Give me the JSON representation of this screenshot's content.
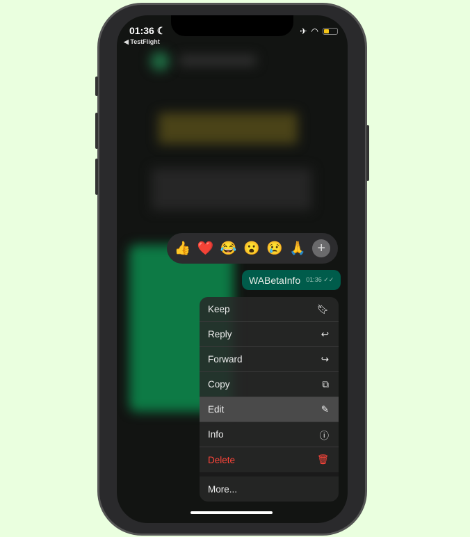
{
  "status": {
    "time": "01:36",
    "back_label": "◀ TestFlight",
    "icons": [
      "moon-icon",
      "airplane-icon",
      "wifi-icon",
      "battery-icon"
    ],
    "battery_color": "#f5c518"
  },
  "reactions": [
    "👍",
    "❤️",
    "😂",
    "😮",
    "😢",
    "🙏"
  ],
  "reaction_add": "+",
  "message": {
    "text": "WABetaInfo",
    "time": "01:36",
    "ticks": "✓✓"
  },
  "menu": [
    {
      "label": "Keep",
      "icon": "bookmark-icon",
      "glyph": "🔖︎"
    },
    {
      "label": "Reply",
      "icon": "reply-icon",
      "glyph": "↩"
    },
    {
      "label": "Forward",
      "icon": "forward-icon",
      "glyph": "↪"
    },
    {
      "label": "Copy",
      "icon": "copy-icon",
      "glyph": "⧉"
    },
    {
      "label": "Edit",
      "icon": "pencil-icon",
      "glyph": "✎"
    },
    {
      "label": "Info",
      "icon": "info-icon",
      "glyph": "ⓘ"
    },
    {
      "label": "Delete",
      "icon": "trash-icon",
      "glyph": "🗑︎"
    }
  ],
  "more_label": "More...",
  "colors": {
    "bubble": "#005c4b",
    "delete": "#ff453a",
    "background": "#eaffdf"
  }
}
